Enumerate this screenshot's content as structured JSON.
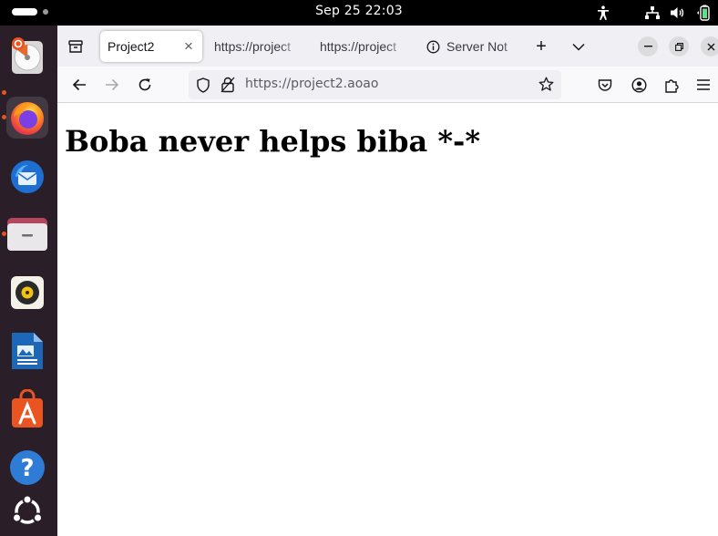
{
  "top_bar": {
    "clock": "Sep 25  22:03",
    "tray_icons": [
      "accessibility-icon",
      "network-icon",
      "volume-icon",
      "battery-icon"
    ]
  },
  "dock": {
    "apps": [
      {
        "name": "Disk Usage Analyzer",
        "icon": "disk-analyzer-icon",
        "running": true
      },
      {
        "name": "Firefox",
        "icon": "firefox-icon",
        "running": true,
        "active": true
      },
      {
        "name": "Thunderbird",
        "icon": "thunderbird-icon",
        "running": false
      },
      {
        "name": "Files",
        "icon": "files-icon",
        "running": true
      },
      {
        "name": "Rhythmbox",
        "icon": "rhythmbox-icon",
        "running": false
      },
      {
        "name": "LibreOffice Writer",
        "icon": "writer-icon",
        "running": false
      },
      {
        "name": "App Center",
        "icon": "app-center-icon",
        "running": false
      },
      {
        "name": "Help",
        "icon": "help-icon",
        "running": false
      },
      {
        "name": "Ubuntu",
        "icon": "ubuntu-icon",
        "running": false
      }
    ]
  },
  "browser": {
    "tabs": [
      {
        "label": "Project2",
        "selected": true,
        "close_glyph": "×"
      },
      {
        "label": "https://project",
        "selected": false
      },
      {
        "label": "https://project",
        "selected": false
      },
      {
        "label": "Server Not",
        "selected": false,
        "icon": "info-icon"
      }
    ],
    "new_tab_glyph": "+",
    "address": "https://project2.aoao"
  },
  "page": {
    "heading": "Boba never helps biba *-*"
  },
  "colors": {
    "dock_bg": "#2a1e28",
    "tab_strip_bg": "#f0f0f4",
    "nav_bg": "#f9f9fb",
    "running_dot": "#e9541d"
  }
}
